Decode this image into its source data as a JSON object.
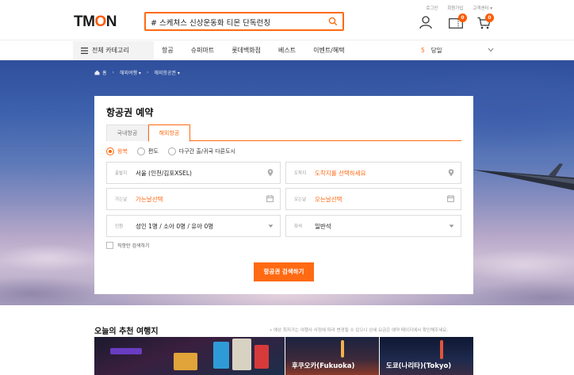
{
  "brand": {
    "logo_pre": "TM",
    "logo_o": "O",
    "logo_post": "N",
    "accent": "#ff6a13"
  },
  "search": {
    "value": "# 스케쳐스 신상운동화 티몬 단독런칭"
  },
  "toplinks": [
    "로그인",
    "회원가입",
    "고객센터 ▾"
  ],
  "header_icons": {
    "mypage": "user-icon",
    "coupon_badge": "0",
    "cart_badge": "0"
  },
  "nav": {
    "category": "전체 카테고리",
    "links": [
      "항공",
      "슈퍼마트",
      "롯데백화점",
      "베스트",
      "이벤트/혜택"
    ],
    "weather_num": "5",
    "weather_text": "당일"
  },
  "breadcrumb": [
    "홈",
    "해외여행 ▾",
    "해외항공권 ▾"
  ],
  "booking": {
    "title": "항공권 예약",
    "tabs": [
      "국내항공",
      "해외항공"
    ],
    "radios": [
      "왕복",
      "편도",
      "다구간 출/귀국 다른도시"
    ],
    "depart_label": "출발지",
    "depart_value": "서울 (인천/김포XSEL)",
    "arrive_label": "도착지",
    "arrive_value": "도착지를 선택하세요",
    "go_label": "가는날",
    "go_value": "가는날선택",
    "return_label": "오는날",
    "return_value": "오는날선택",
    "pax_label": "인원",
    "pax_value": "성인 1명 / 소아 0명 / 유아 0명",
    "seat_label": "좌석",
    "seat_value": "일반석",
    "direct_label": "직항만 검색하기",
    "submit": "항공권 검색하기"
  },
  "recommend": {
    "title": "오늘의 추천 여행지",
    "note": "• 예상 최저가는 여행사 사정에 따라 변경될 수 있으니 상세 요금은 예약 페이지에서 확인해주세요.",
    "cards": [
      "",
      "후쿠오카(Fukuoka)",
      "도쿄(나리타)(Tokyo)"
    ]
  }
}
